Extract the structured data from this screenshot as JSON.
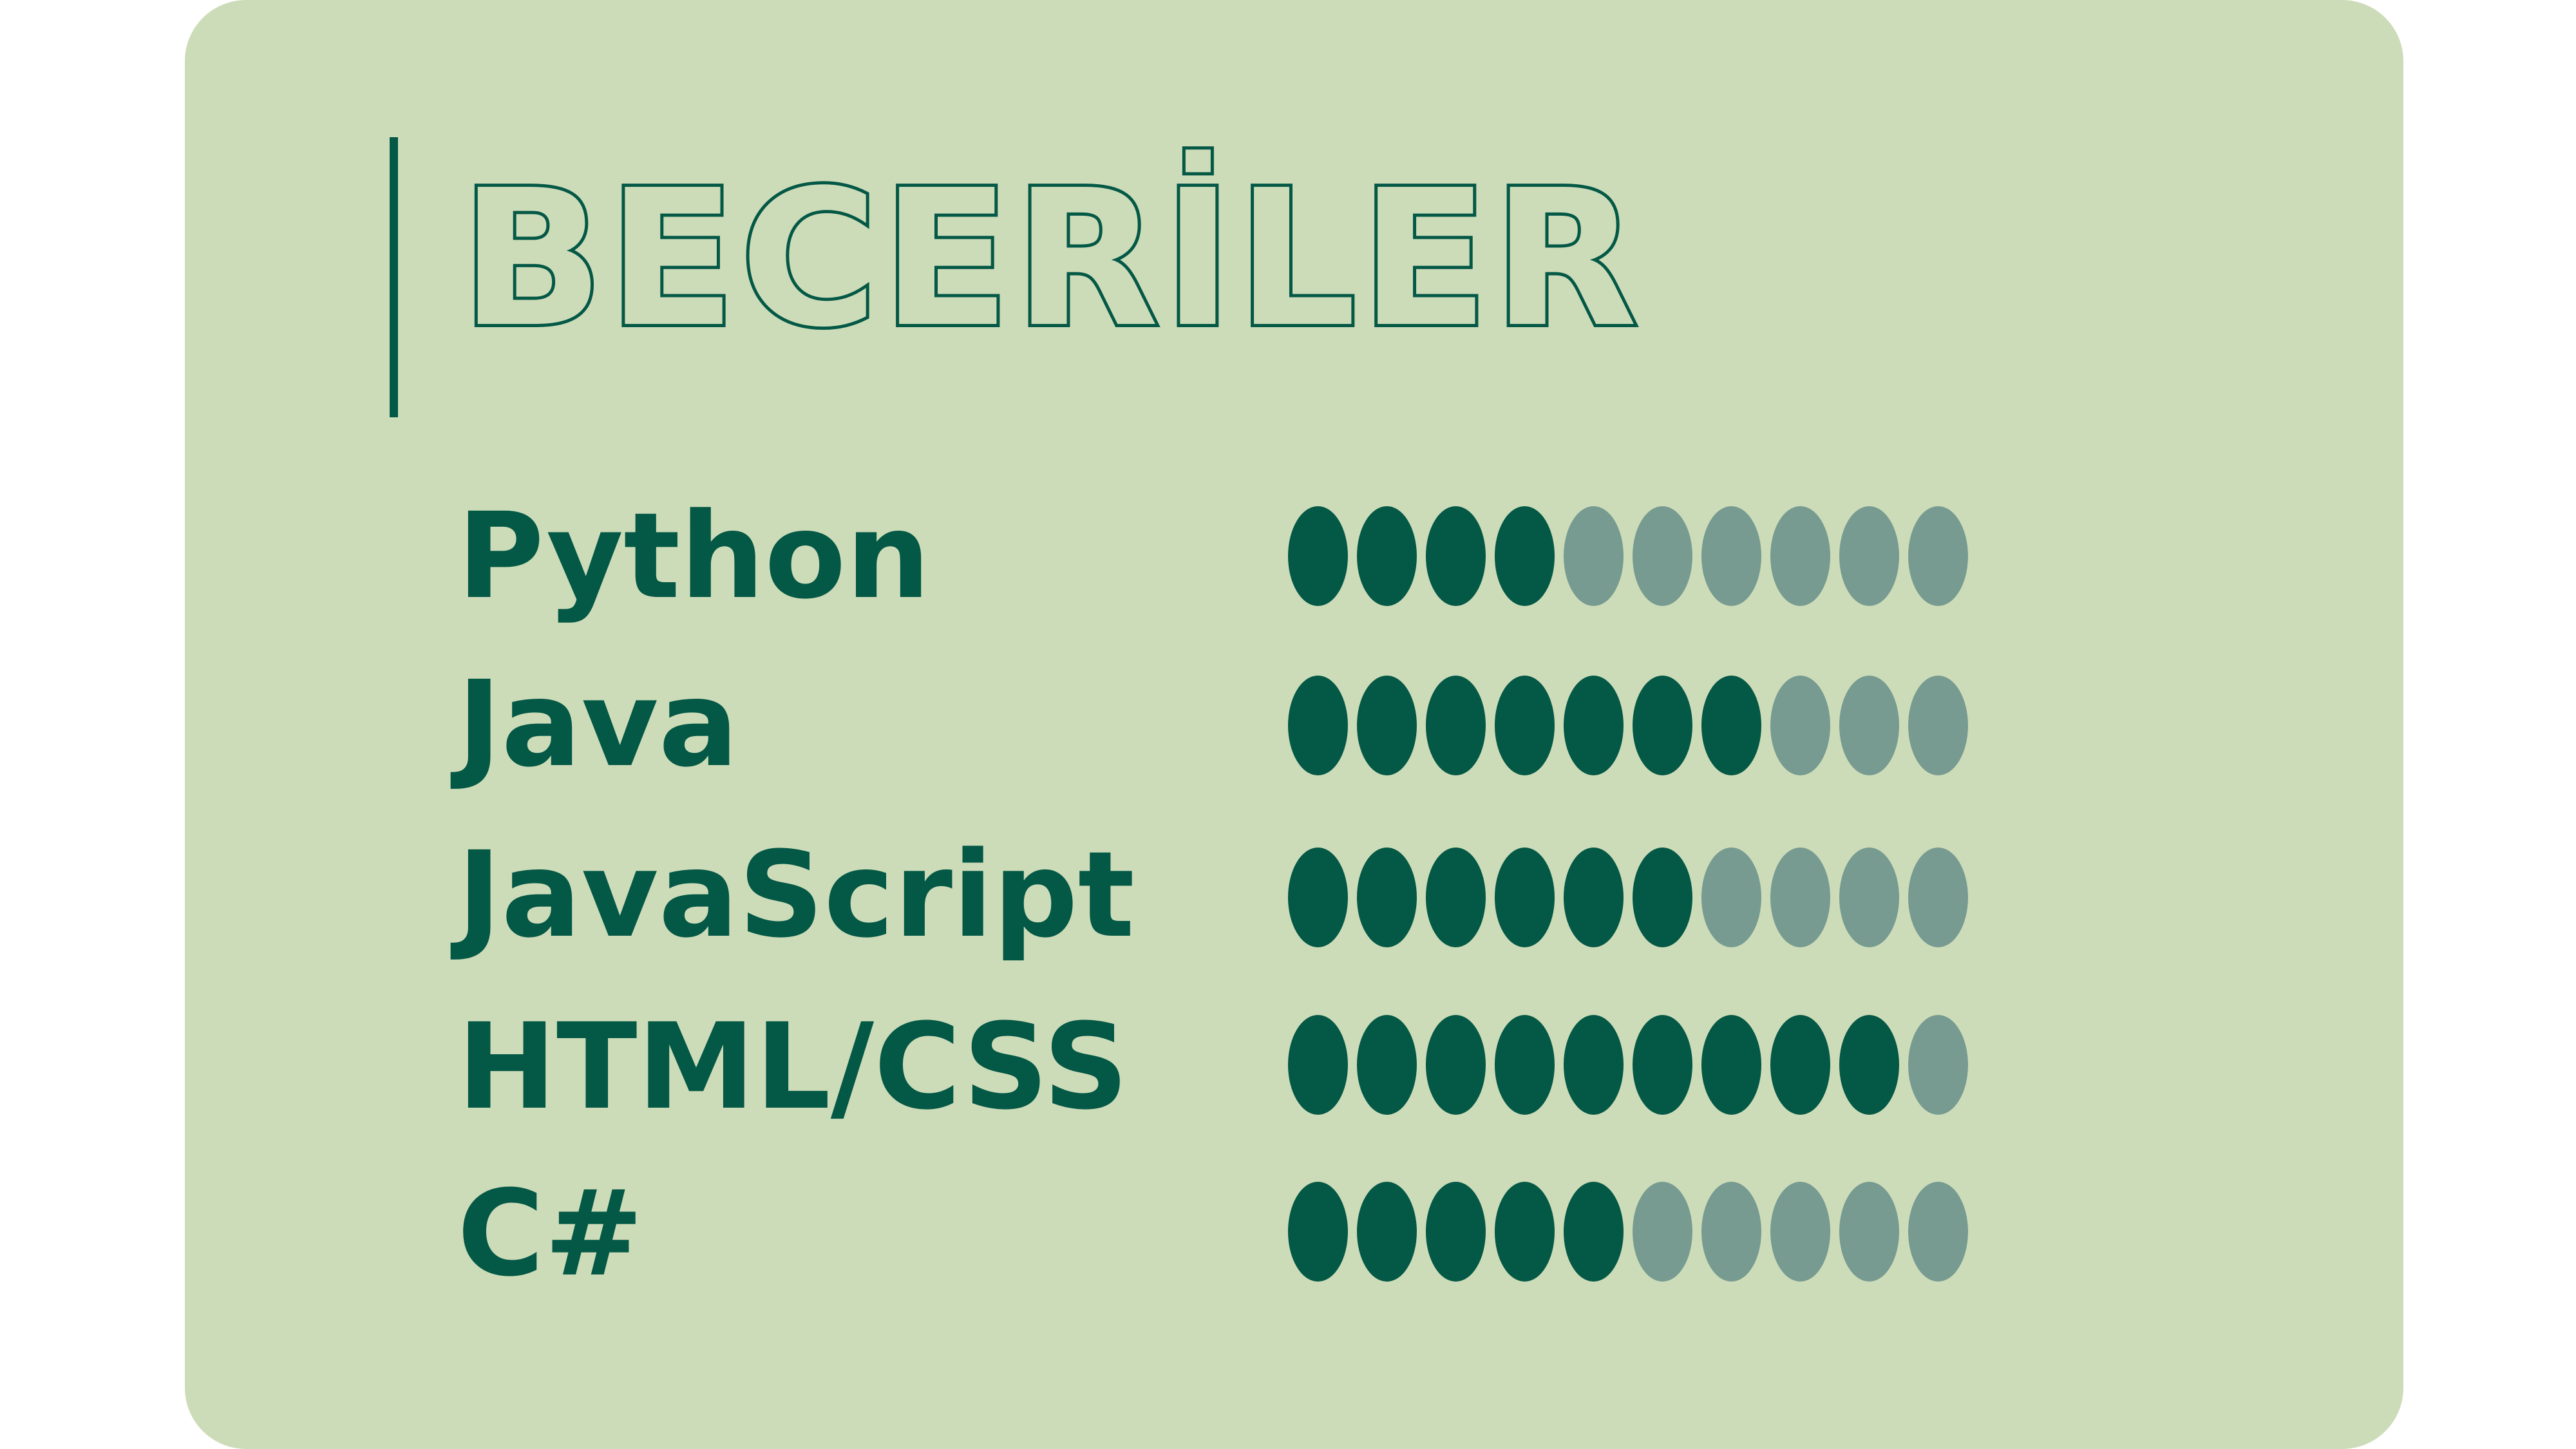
{
  "title": "BECERİLER",
  "colors": {
    "background": "#cddcb8",
    "accent": "#045846",
    "dot_filled": "#045846",
    "dot_empty": "#779b91"
  },
  "skills": [
    {
      "name": "Python",
      "level": 4,
      "max": 10
    },
    {
      "name": "Java",
      "level": 7,
      "max": 10
    },
    {
      "name": "JavaScript",
      "level": 6,
      "max": 10
    },
    {
      "name": "HTML/CSS",
      "level": 9,
      "max": 10
    },
    {
      "name": "C#",
      "level": 5,
      "max": 10
    }
  ]
}
